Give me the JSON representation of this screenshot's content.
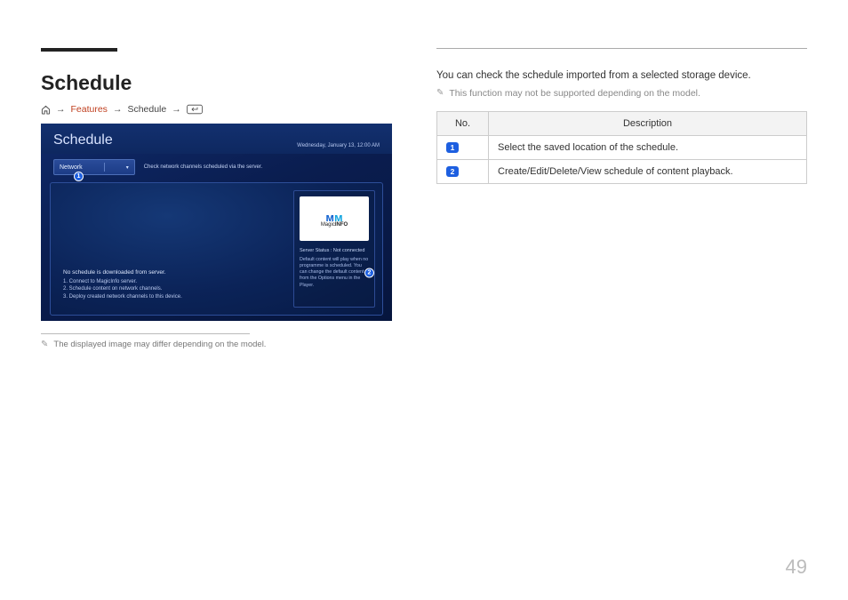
{
  "pageNumber": "49",
  "heading": "Schedule",
  "breadcrumb": {
    "features": "Features",
    "schedule": "Schedule"
  },
  "screenshot": {
    "title": "Schedule",
    "datetime": "Wednesday, January 13, 12:00 AM",
    "networkLabel": "Network",
    "toolbarText": "Check network channels scheduled via the server.",
    "msgTitle": "No schedule is downloaded from server.",
    "msgLine1": "1. Connect to MagicInfo server.",
    "msgLine2": "2. Schedule content on network channels.",
    "msgLine3": "3. Deploy created network channels to this device.",
    "magicPrefix": "Magic",
    "magicSuffix": "INFO",
    "serverStatus": "Server Status : Not connected",
    "defaultText": "Default content will play when no programme is scheduled. You can change the default content from the Options menu in the Player.",
    "badge1": "1",
    "badge2": "2"
  },
  "footnote": "The displayed image may differ depending on the model.",
  "rightIntro": "You can check the schedule imported from a selected storage device.",
  "rightNote": "This function may not be supported depending on the model.",
  "table": {
    "hNo": "No.",
    "hDesc": "Description",
    "rows": [
      {
        "num": "1",
        "desc": "Select the saved location of the schedule."
      },
      {
        "num": "2",
        "desc": "Create/Edit/Delete/View schedule of content playback."
      }
    ]
  }
}
